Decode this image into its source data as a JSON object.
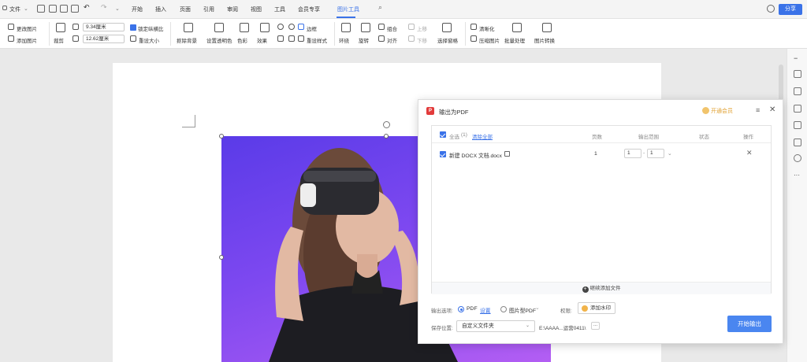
{
  "menubar": {
    "file": "文件",
    "tabs": [
      "开始",
      "插入",
      "页面",
      "引用",
      "审阅",
      "视图",
      "工具",
      "会员专享",
      "图片工具"
    ],
    "share": "分享"
  },
  "ribbon": {
    "change_picture": "更改图片",
    "add_picture": "添加图片",
    "crop": "裁剪",
    "width_value": "9.34厘米",
    "height_value": "12.62厘米",
    "lock_ratio": "锁定纵横比",
    "reset_size": "重设大小",
    "remove_bg": "抠除背景",
    "set_transparent": "设置透明色",
    "color": "色彩",
    "effects": "效果",
    "border": "边框",
    "reset_style": "重设样式",
    "wrap": "环绕",
    "rotate": "旋转",
    "group": "组合",
    "align": "对齐",
    "move_up": "上移",
    "move_down": "下移",
    "selection_pane": "选择窗格",
    "sharpen": "清晰化",
    "compress": "压缩图片",
    "batch": "批量处理",
    "convert": "图片转换"
  },
  "dialog": {
    "title": "输出为PDF",
    "member": "开通会员",
    "header": {
      "select_all": "全选",
      "count": "(1)",
      "clear_all": "清除全部",
      "pages": "页数",
      "range": "输出范围",
      "status": "状态",
      "actions": "操作"
    },
    "file_row": {
      "name": "新建 DOCX 文档.docx",
      "pages": "1",
      "range_from": "1",
      "range_to": "1",
      "range_sep": "-"
    },
    "add_more": "继续添加文件",
    "output_options_label": "输出选项:",
    "opt_pdf": "PDF",
    "opt_settings": "设置",
    "opt_image_pdf": "图片型PDF",
    "permission_label": "权限:",
    "add_watermark": "添加水印",
    "save_location_label": "保存位置:",
    "save_location_value": "自定义文件夹",
    "save_path": "E:\\AAAA...运营0411\\",
    "path_more": "...",
    "start_button": "开始输出"
  }
}
